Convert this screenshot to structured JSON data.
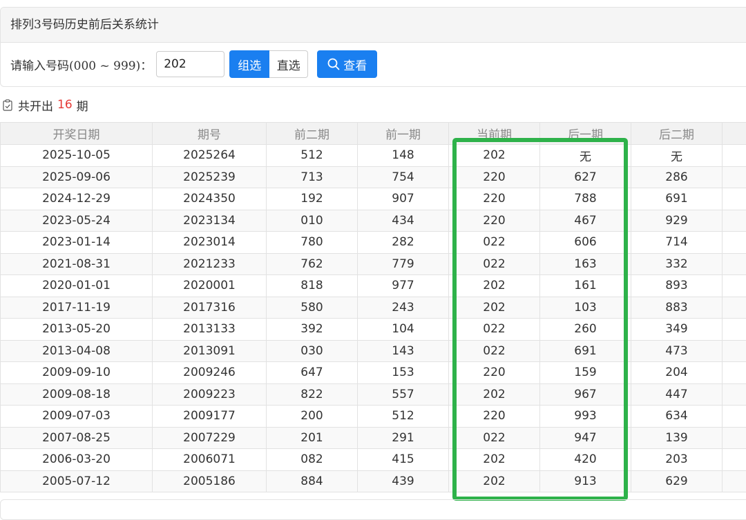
{
  "header": {
    "title": "排列3号码历史前后关系统计"
  },
  "form": {
    "label": "请输入号码(000 ~ 999)：",
    "input_value": "202",
    "btn_group": "组选",
    "btn_direct": "直选",
    "search_label": "查看"
  },
  "summary": {
    "prefix": "共开出",
    "count": "16",
    "suffix": "期"
  },
  "table": {
    "columns": [
      "开奖日期",
      "期号",
      "前二期",
      "前一期",
      "当前期",
      "后一期",
      "后二期"
    ],
    "rows": [
      [
        "2025-10-05",
        "2025264",
        "512",
        "148",
        "202",
        "无",
        "无"
      ],
      [
        "2025-09-06",
        "2025239",
        "713",
        "754",
        "220",
        "627",
        "286"
      ],
      [
        "2024-12-29",
        "2024350",
        "192",
        "907",
        "220",
        "788",
        "691"
      ],
      [
        "2023-05-24",
        "2023134",
        "010",
        "434",
        "220",
        "467",
        "929"
      ],
      [
        "2023-01-14",
        "2023014",
        "780",
        "282",
        "022",
        "606",
        "714"
      ],
      [
        "2021-08-31",
        "2021233",
        "762",
        "779",
        "022",
        "163",
        "332"
      ],
      [
        "2020-01-01",
        "2020001",
        "818",
        "977",
        "202",
        "161",
        "893"
      ],
      [
        "2017-11-19",
        "2017316",
        "580",
        "243",
        "202",
        "103",
        "883"
      ],
      [
        "2013-05-20",
        "2013133",
        "392",
        "104",
        "022",
        "260",
        "349"
      ],
      [
        "2013-04-08",
        "2013091",
        "030",
        "143",
        "022",
        "691",
        "473"
      ],
      [
        "2009-09-10",
        "2009246",
        "647",
        "153",
        "220",
        "159",
        "204"
      ],
      [
        "2009-08-18",
        "2009223",
        "822",
        "557",
        "202",
        "967",
        "447"
      ],
      [
        "2009-07-03",
        "2009177",
        "200",
        "512",
        "220",
        "993",
        "634"
      ],
      [
        "2007-08-25",
        "2007229",
        "201",
        "291",
        "022",
        "947",
        "139"
      ],
      [
        "2006-03-20",
        "2006071",
        "082",
        "415",
        "202",
        "420",
        "203"
      ],
      [
        "2005-07-12",
        "2005186",
        "884",
        "439",
        "202",
        "913",
        "629"
      ]
    ]
  },
  "colors": {
    "primary": "#1a7ff0",
    "highlight": "#2eb24a",
    "count": "#e53935"
  },
  "icons": {
    "summary": "checklist-icon",
    "search": "search-icon"
  }
}
